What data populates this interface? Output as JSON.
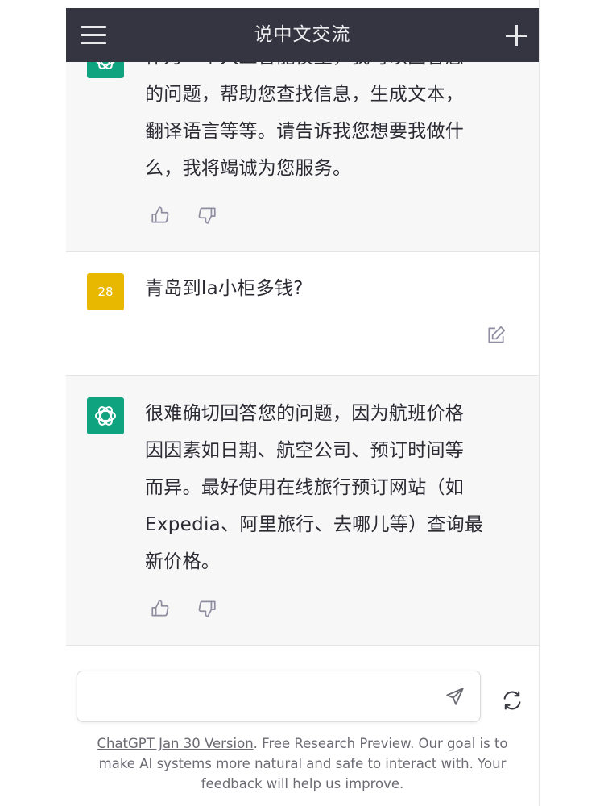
{
  "header": {
    "title": "说中文交流"
  },
  "messages": {
    "first_ai": {
      "partial_line": "作为一个人工智能模型，我可以回答您",
      "lines": [
        "的问题，帮助您查找信息，生成文本，",
        "翻译语言等等。请告诉我您想要我做什",
        "么，我将竭诚为您服务。"
      ]
    },
    "user": {
      "avatar_label": "28",
      "text": "青岛到la小柜多钱?"
    },
    "second_ai": {
      "lines": [
        "很难确切回答您的问题，因为航班价格",
        "因因素如日期、航空公司、预订时间等",
        "而异。最好使用在线旅行预订网站（如",
        "Expedia、阿里旅行、去哪儿等）查询最",
        "新价格。"
      ]
    }
  },
  "composer": {
    "placeholder": ""
  },
  "footer": {
    "link": "ChatGPT Jan 30 Version",
    "text_1": ". Free Research Preview. Our goal is to",
    "text_2": "make AI systems more natural and safe to interact with. Your",
    "text_3": "feedback will help us improve."
  },
  "icons": {
    "menu": "hamburger-icon",
    "new_chat": "plus-icon",
    "gpt_logo": "openai-logo-icon",
    "thumbs_up": "thumbs-up-icon",
    "thumbs_down": "thumbs-down-icon",
    "edit": "edit-icon",
    "send": "send-icon",
    "regenerate": "refresh-icon"
  },
  "colors": {
    "header_bg": "#343541",
    "gpt_green": "#10a37f",
    "user_avatar": "#e8b800",
    "ai_bg": "#f7f7f8"
  }
}
